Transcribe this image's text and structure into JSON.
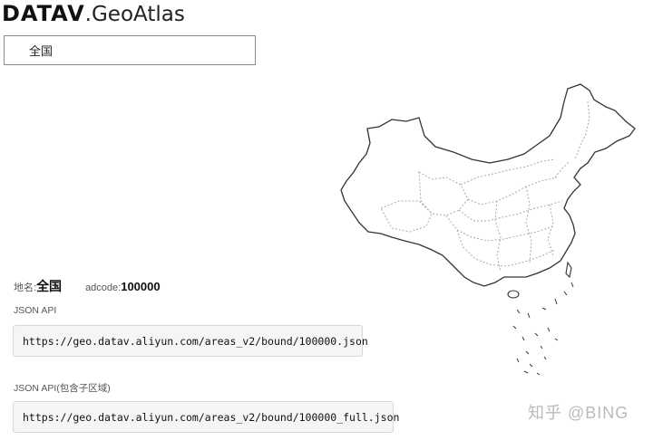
{
  "logo": {
    "brand": "DATAV",
    "product": ".GeoAtlas"
  },
  "region_select": {
    "selected": "全国"
  },
  "info": {
    "name_label": "地名:",
    "name_value": "全国",
    "adcode_label": "adcode:",
    "adcode_value": "100000"
  },
  "api": [
    {
      "label": "JSON API",
      "url": "https://geo.datav.aliyun.com/areas_v2/bound/100000.json"
    },
    {
      "label": "JSON API(包含子区域)",
      "url": "https://geo.datav.aliyun.com/areas_v2/bound/100000_full.json"
    }
  ],
  "watermark": "知乎 @BING",
  "colors": {
    "map_outline": "#333333",
    "map_province_lines": "#aaaaaa",
    "code_bg": "#f5f5f5"
  }
}
